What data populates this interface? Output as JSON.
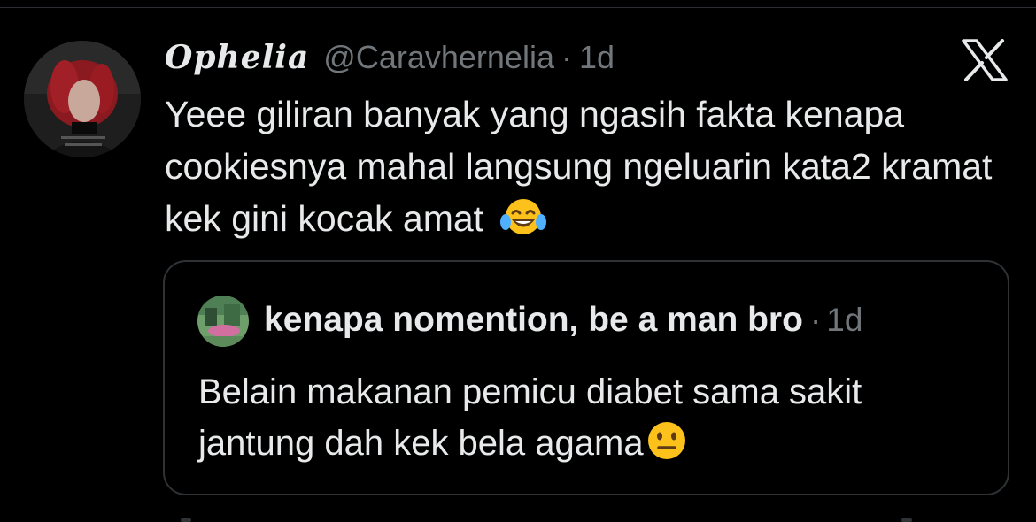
{
  "tweet": {
    "display_name": "Ophelia",
    "handle": "@Caravhernelia",
    "separator": "·",
    "time": "1d",
    "text": "Yeee giliran banyak yang ngasih fakta kenapa cookiesnya mahal langsung ngeluarin kata2 kramat kek gini kocak amat",
    "emoji": "face-with-tears-of-joy"
  },
  "platform": {
    "logo": "x-logo"
  },
  "quote": {
    "display_name": "kenapa nomention, be a man bro",
    "separator": "·",
    "time": "1d",
    "text": "Belain makanan pemicu diabet sama sakit jantung dah kek bela agama",
    "emoji": "neutral-face"
  },
  "colors": {
    "background": "#000000",
    "text_primary": "#e7e9ea",
    "text_secondary": "#71767b",
    "border": "#2f3336"
  }
}
